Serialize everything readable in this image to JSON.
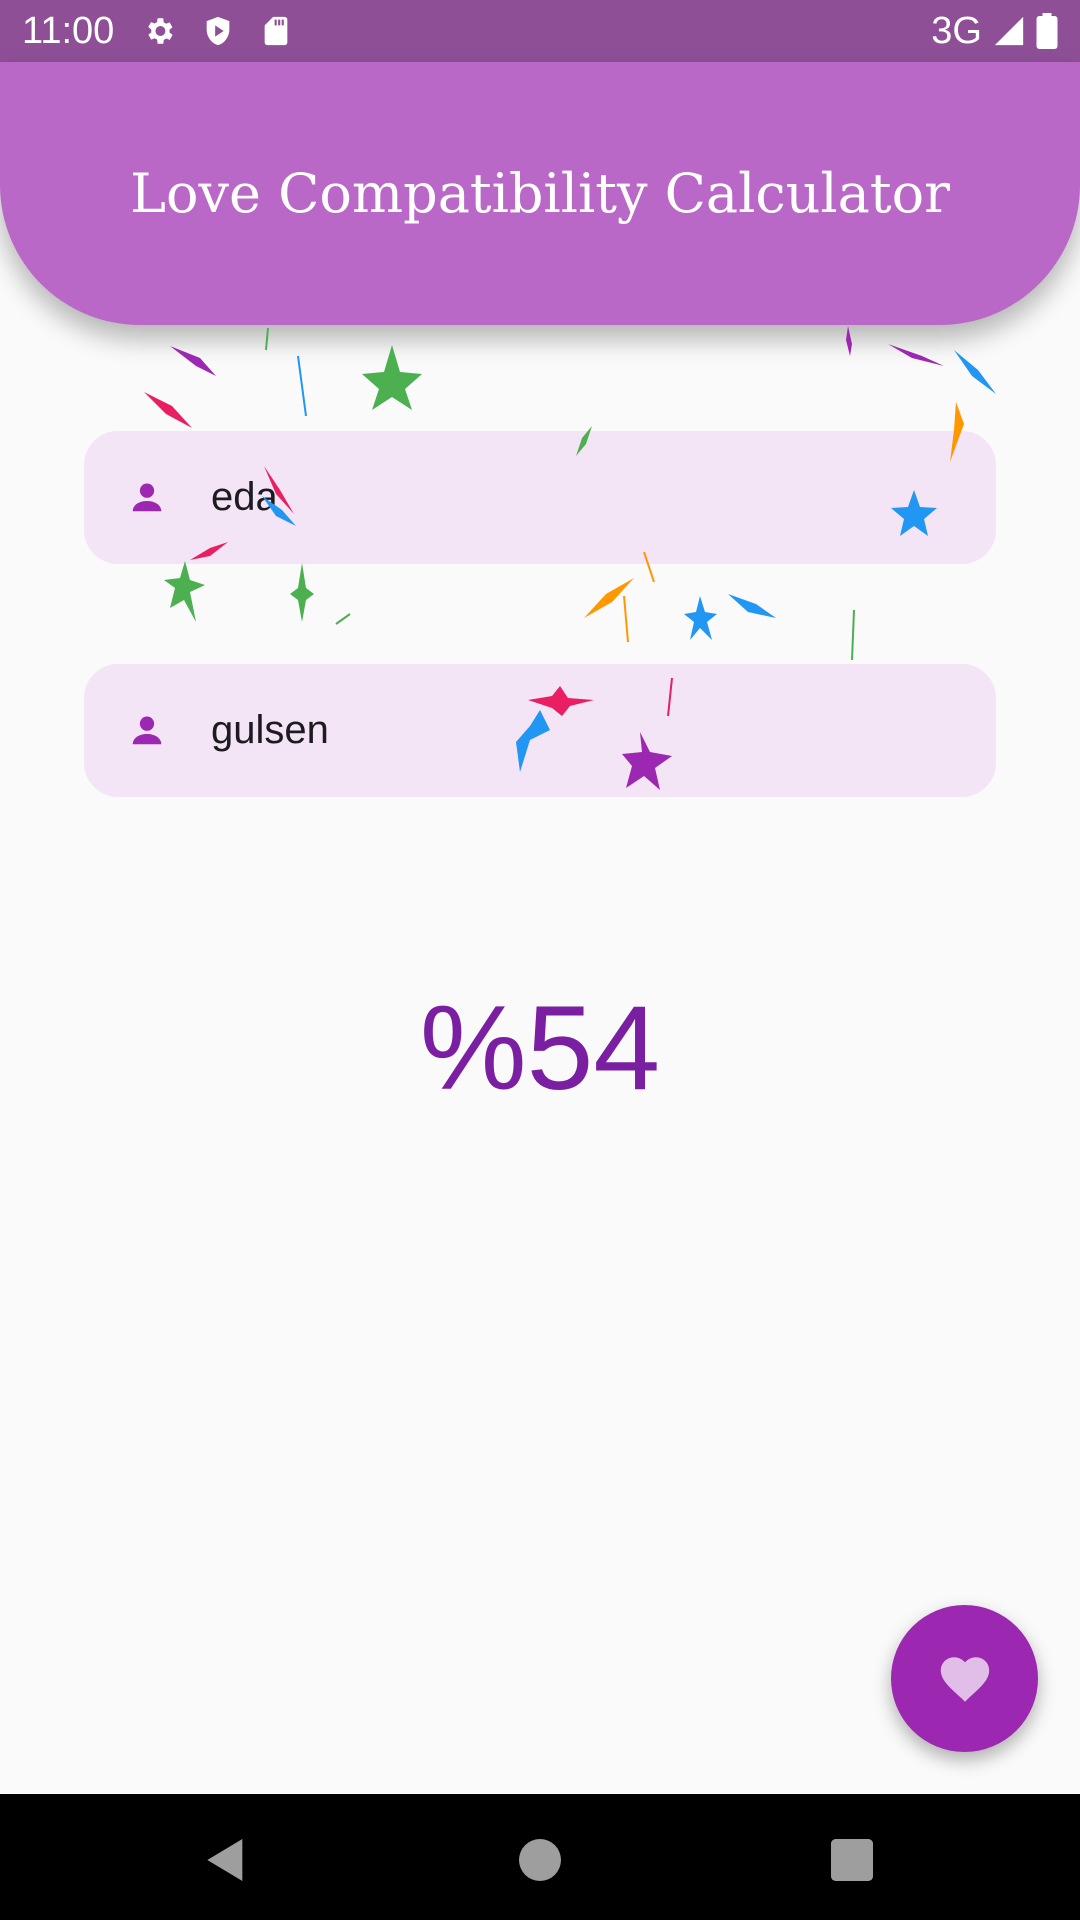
{
  "status_bar": {
    "time": "11:00",
    "left_icons": [
      "settings-icon",
      "shield-icon",
      "sd-card-icon"
    ],
    "network_label": "3G",
    "right_icons": [
      "signal-icon",
      "battery-icon"
    ]
  },
  "app_bar": {
    "title": "Love Compatibility Calculator",
    "color": "#b968c7"
  },
  "form": {
    "first_name": {
      "icon": "person-icon",
      "value": "eda"
    },
    "second_name": {
      "icon": "person-icon",
      "value": "gulsen"
    }
  },
  "result": {
    "text": "%54",
    "color": "#7b1fa2"
  },
  "fab": {
    "icon": "heart-icon",
    "color": "#9c27b0"
  },
  "confetti": {
    "colors": [
      "#9c27b0",
      "#e91e63",
      "#4caf50",
      "#2196f3",
      "#ff9800"
    ]
  },
  "nav_bar": {
    "buttons": [
      "back-icon",
      "home-icon",
      "recents-icon"
    ]
  }
}
